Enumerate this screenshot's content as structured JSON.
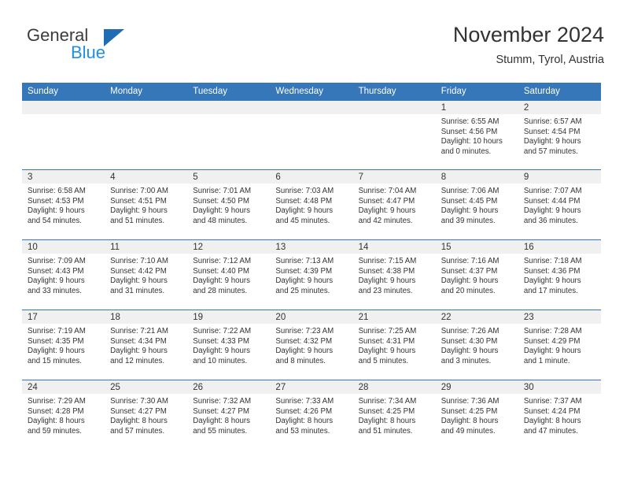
{
  "brand": {
    "general": "General",
    "blue": "Blue",
    "triangle_color": "#1f6cb4",
    "blue_color": "#1f8fe0"
  },
  "header": {
    "title": "November 2024",
    "subtitle": "Stumm, Tyrol, Austria"
  },
  "theme": {
    "header_bg": "#3577b8",
    "daynum_bg": "#f0f0f0",
    "text": "#333333"
  },
  "weekday_headers": [
    "Sunday",
    "Monday",
    "Tuesday",
    "Wednesday",
    "Thursday",
    "Friday",
    "Saturday"
  ],
  "weeks": [
    [
      {
        "day": ""
      },
      {
        "day": ""
      },
      {
        "day": ""
      },
      {
        "day": ""
      },
      {
        "day": ""
      },
      {
        "day": "1",
        "sunrise": "Sunrise: 6:55 AM",
        "sunset": "Sunset: 4:56 PM",
        "daylight1": "Daylight: 10 hours",
        "daylight2": "and 0 minutes."
      },
      {
        "day": "2",
        "sunrise": "Sunrise: 6:57 AM",
        "sunset": "Sunset: 4:54 PM",
        "daylight1": "Daylight: 9 hours",
        "daylight2": "and 57 minutes."
      }
    ],
    [
      {
        "day": "3",
        "sunrise": "Sunrise: 6:58 AM",
        "sunset": "Sunset: 4:53 PM",
        "daylight1": "Daylight: 9 hours",
        "daylight2": "and 54 minutes."
      },
      {
        "day": "4",
        "sunrise": "Sunrise: 7:00 AM",
        "sunset": "Sunset: 4:51 PM",
        "daylight1": "Daylight: 9 hours",
        "daylight2": "and 51 minutes."
      },
      {
        "day": "5",
        "sunrise": "Sunrise: 7:01 AM",
        "sunset": "Sunset: 4:50 PM",
        "daylight1": "Daylight: 9 hours",
        "daylight2": "and 48 minutes."
      },
      {
        "day": "6",
        "sunrise": "Sunrise: 7:03 AM",
        "sunset": "Sunset: 4:48 PM",
        "daylight1": "Daylight: 9 hours",
        "daylight2": "and 45 minutes."
      },
      {
        "day": "7",
        "sunrise": "Sunrise: 7:04 AM",
        "sunset": "Sunset: 4:47 PM",
        "daylight1": "Daylight: 9 hours",
        "daylight2": "and 42 minutes."
      },
      {
        "day": "8",
        "sunrise": "Sunrise: 7:06 AM",
        "sunset": "Sunset: 4:45 PM",
        "daylight1": "Daylight: 9 hours",
        "daylight2": "and 39 minutes."
      },
      {
        "day": "9",
        "sunrise": "Sunrise: 7:07 AM",
        "sunset": "Sunset: 4:44 PM",
        "daylight1": "Daylight: 9 hours",
        "daylight2": "and 36 minutes."
      }
    ],
    [
      {
        "day": "10",
        "sunrise": "Sunrise: 7:09 AM",
        "sunset": "Sunset: 4:43 PM",
        "daylight1": "Daylight: 9 hours",
        "daylight2": "and 33 minutes."
      },
      {
        "day": "11",
        "sunrise": "Sunrise: 7:10 AM",
        "sunset": "Sunset: 4:42 PM",
        "daylight1": "Daylight: 9 hours",
        "daylight2": "and 31 minutes."
      },
      {
        "day": "12",
        "sunrise": "Sunrise: 7:12 AM",
        "sunset": "Sunset: 4:40 PM",
        "daylight1": "Daylight: 9 hours",
        "daylight2": "and 28 minutes."
      },
      {
        "day": "13",
        "sunrise": "Sunrise: 7:13 AM",
        "sunset": "Sunset: 4:39 PM",
        "daylight1": "Daylight: 9 hours",
        "daylight2": "and 25 minutes."
      },
      {
        "day": "14",
        "sunrise": "Sunrise: 7:15 AM",
        "sunset": "Sunset: 4:38 PM",
        "daylight1": "Daylight: 9 hours",
        "daylight2": "and 23 minutes."
      },
      {
        "day": "15",
        "sunrise": "Sunrise: 7:16 AM",
        "sunset": "Sunset: 4:37 PM",
        "daylight1": "Daylight: 9 hours",
        "daylight2": "and 20 minutes."
      },
      {
        "day": "16",
        "sunrise": "Sunrise: 7:18 AM",
        "sunset": "Sunset: 4:36 PM",
        "daylight1": "Daylight: 9 hours",
        "daylight2": "and 17 minutes."
      }
    ],
    [
      {
        "day": "17",
        "sunrise": "Sunrise: 7:19 AM",
        "sunset": "Sunset: 4:35 PM",
        "daylight1": "Daylight: 9 hours",
        "daylight2": "and 15 minutes."
      },
      {
        "day": "18",
        "sunrise": "Sunrise: 7:21 AM",
        "sunset": "Sunset: 4:34 PM",
        "daylight1": "Daylight: 9 hours",
        "daylight2": "and 12 minutes."
      },
      {
        "day": "19",
        "sunrise": "Sunrise: 7:22 AM",
        "sunset": "Sunset: 4:33 PM",
        "daylight1": "Daylight: 9 hours",
        "daylight2": "and 10 minutes."
      },
      {
        "day": "20",
        "sunrise": "Sunrise: 7:23 AM",
        "sunset": "Sunset: 4:32 PM",
        "daylight1": "Daylight: 9 hours",
        "daylight2": "and 8 minutes."
      },
      {
        "day": "21",
        "sunrise": "Sunrise: 7:25 AM",
        "sunset": "Sunset: 4:31 PM",
        "daylight1": "Daylight: 9 hours",
        "daylight2": "and 5 minutes."
      },
      {
        "day": "22",
        "sunrise": "Sunrise: 7:26 AM",
        "sunset": "Sunset: 4:30 PM",
        "daylight1": "Daylight: 9 hours",
        "daylight2": "and 3 minutes."
      },
      {
        "day": "23",
        "sunrise": "Sunrise: 7:28 AM",
        "sunset": "Sunset: 4:29 PM",
        "daylight1": "Daylight: 9 hours",
        "daylight2": "and 1 minute."
      }
    ],
    [
      {
        "day": "24",
        "sunrise": "Sunrise: 7:29 AM",
        "sunset": "Sunset: 4:28 PM",
        "daylight1": "Daylight: 8 hours",
        "daylight2": "and 59 minutes."
      },
      {
        "day": "25",
        "sunrise": "Sunrise: 7:30 AM",
        "sunset": "Sunset: 4:27 PM",
        "daylight1": "Daylight: 8 hours",
        "daylight2": "and 57 minutes."
      },
      {
        "day": "26",
        "sunrise": "Sunrise: 7:32 AM",
        "sunset": "Sunset: 4:27 PM",
        "daylight1": "Daylight: 8 hours",
        "daylight2": "and 55 minutes."
      },
      {
        "day": "27",
        "sunrise": "Sunrise: 7:33 AM",
        "sunset": "Sunset: 4:26 PM",
        "daylight1": "Daylight: 8 hours",
        "daylight2": "and 53 minutes."
      },
      {
        "day": "28",
        "sunrise": "Sunrise: 7:34 AM",
        "sunset": "Sunset: 4:25 PM",
        "daylight1": "Daylight: 8 hours",
        "daylight2": "and 51 minutes."
      },
      {
        "day": "29",
        "sunrise": "Sunrise: 7:36 AM",
        "sunset": "Sunset: 4:25 PM",
        "daylight1": "Daylight: 8 hours",
        "daylight2": "and 49 minutes."
      },
      {
        "day": "30",
        "sunrise": "Sunrise: 7:37 AM",
        "sunset": "Sunset: 4:24 PM",
        "daylight1": "Daylight: 8 hours",
        "daylight2": "and 47 minutes."
      }
    ]
  ]
}
